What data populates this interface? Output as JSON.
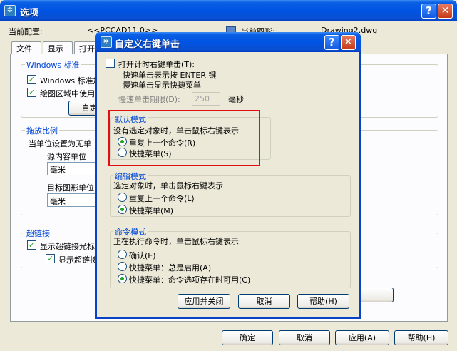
{
  "main_window": {
    "title": "选项",
    "help_glyph": "?",
    "close_glyph": "✕",
    "current_profile_label": "当前配置:",
    "current_profile_value": "<<PCCAD11.0>>",
    "current_drawing_label": "当前图形:",
    "current_drawing_value": "Drawing2.dwg",
    "tabs": [
      "文件",
      "显示",
      "打开"
    ],
    "windows_group": {
      "title": "Windows 标准",
      "options": [
        {
          "label": "Windows 标准加",
          "checked": true
        },
        {
          "label": "绘图区域中使用",
          "checked": true
        }
      ],
      "custom_button": "自定义"
    },
    "scale_group": {
      "title": "拖放比例",
      "desc": "当单位设置为无单",
      "source_label": "源内容单位",
      "source_value": "毫米",
      "target_label": "目标图形单位",
      "target_value": "毫米"
    },
    "hyperlink_group": {
      "title": "超链接",
      "options": [
        {
          "label": "显示超链接光标",
          "checked": true
        },
        {
          "label": "显示超链接",
          "checked": true
        }
      ]
    },
    "bottom_buttons": {
      "ok": "确定",
      "cancel": "取消",
      "apply": "应用(A)",
      "help": "帮助(H)"
    }
  },
  "dialog": {
    "title": "自定义右键单击",
    "help_glyph": "?",
    "close_glyph": "✕",
    "timer_option": {
      "label": "打开计时右键单击(T):",
      "checked": false
    },
    "timer_desc_1": "快速单击表示按 ENTER 键",
    "timer_desc_2": "慢速单击显示快捷菜单",
    "timer_limit_label": "慢速单击期限(D):",
    "timer_limit_value": "250",
    "timer_limit_unit": "毫秒",
    "default_mode": {
      "title": "默认模式",
      "desc": "没有选定对象时，单击鼠标右键表示",
      "options": [
        {
          "label": "重复上一个命令(R)",
          "selected": true
        },
        {
          "label": "快捷菜单(S)",
          "selected": false
        }
      ]
    },
    "edit_mode": {
      "title": "编辑模式",
      "desc": "选定对象时，单击鼠标右键表示",
      "options": [
        {
          "label": "重复上一个命令(L)",
          "selected": false
        },
        {
          "label": "快捷菜单(M)",
          "selected": true
        }
      ]
    },
    "command_mode": {
      "title": "命令模式",
      "desc": "正在执行命令时，单击鼠标右键表示",
      "options": [
        {
          "label": "确认(E)",
          "selected": false
        },
        {
          "label": "快捷菜单：总是启用(A)",
          "selected": false
        },
        {
          "label": "快捷菜单：命令选项存在时可用(C)",
          "selected": true
        }
      ]
    },
    "buttons": {
      "apply_close": "应用并关闭",
      "cancel": "取消",
      "help": "帮助(H)"
    }
  },
  "colors": {
    "titlebar_blue": "#0054e3",
    "group_title_blue": "#0046d5",
    "highlight_red": "#e01010",
    "check_green": "#21a121"
  }
}
